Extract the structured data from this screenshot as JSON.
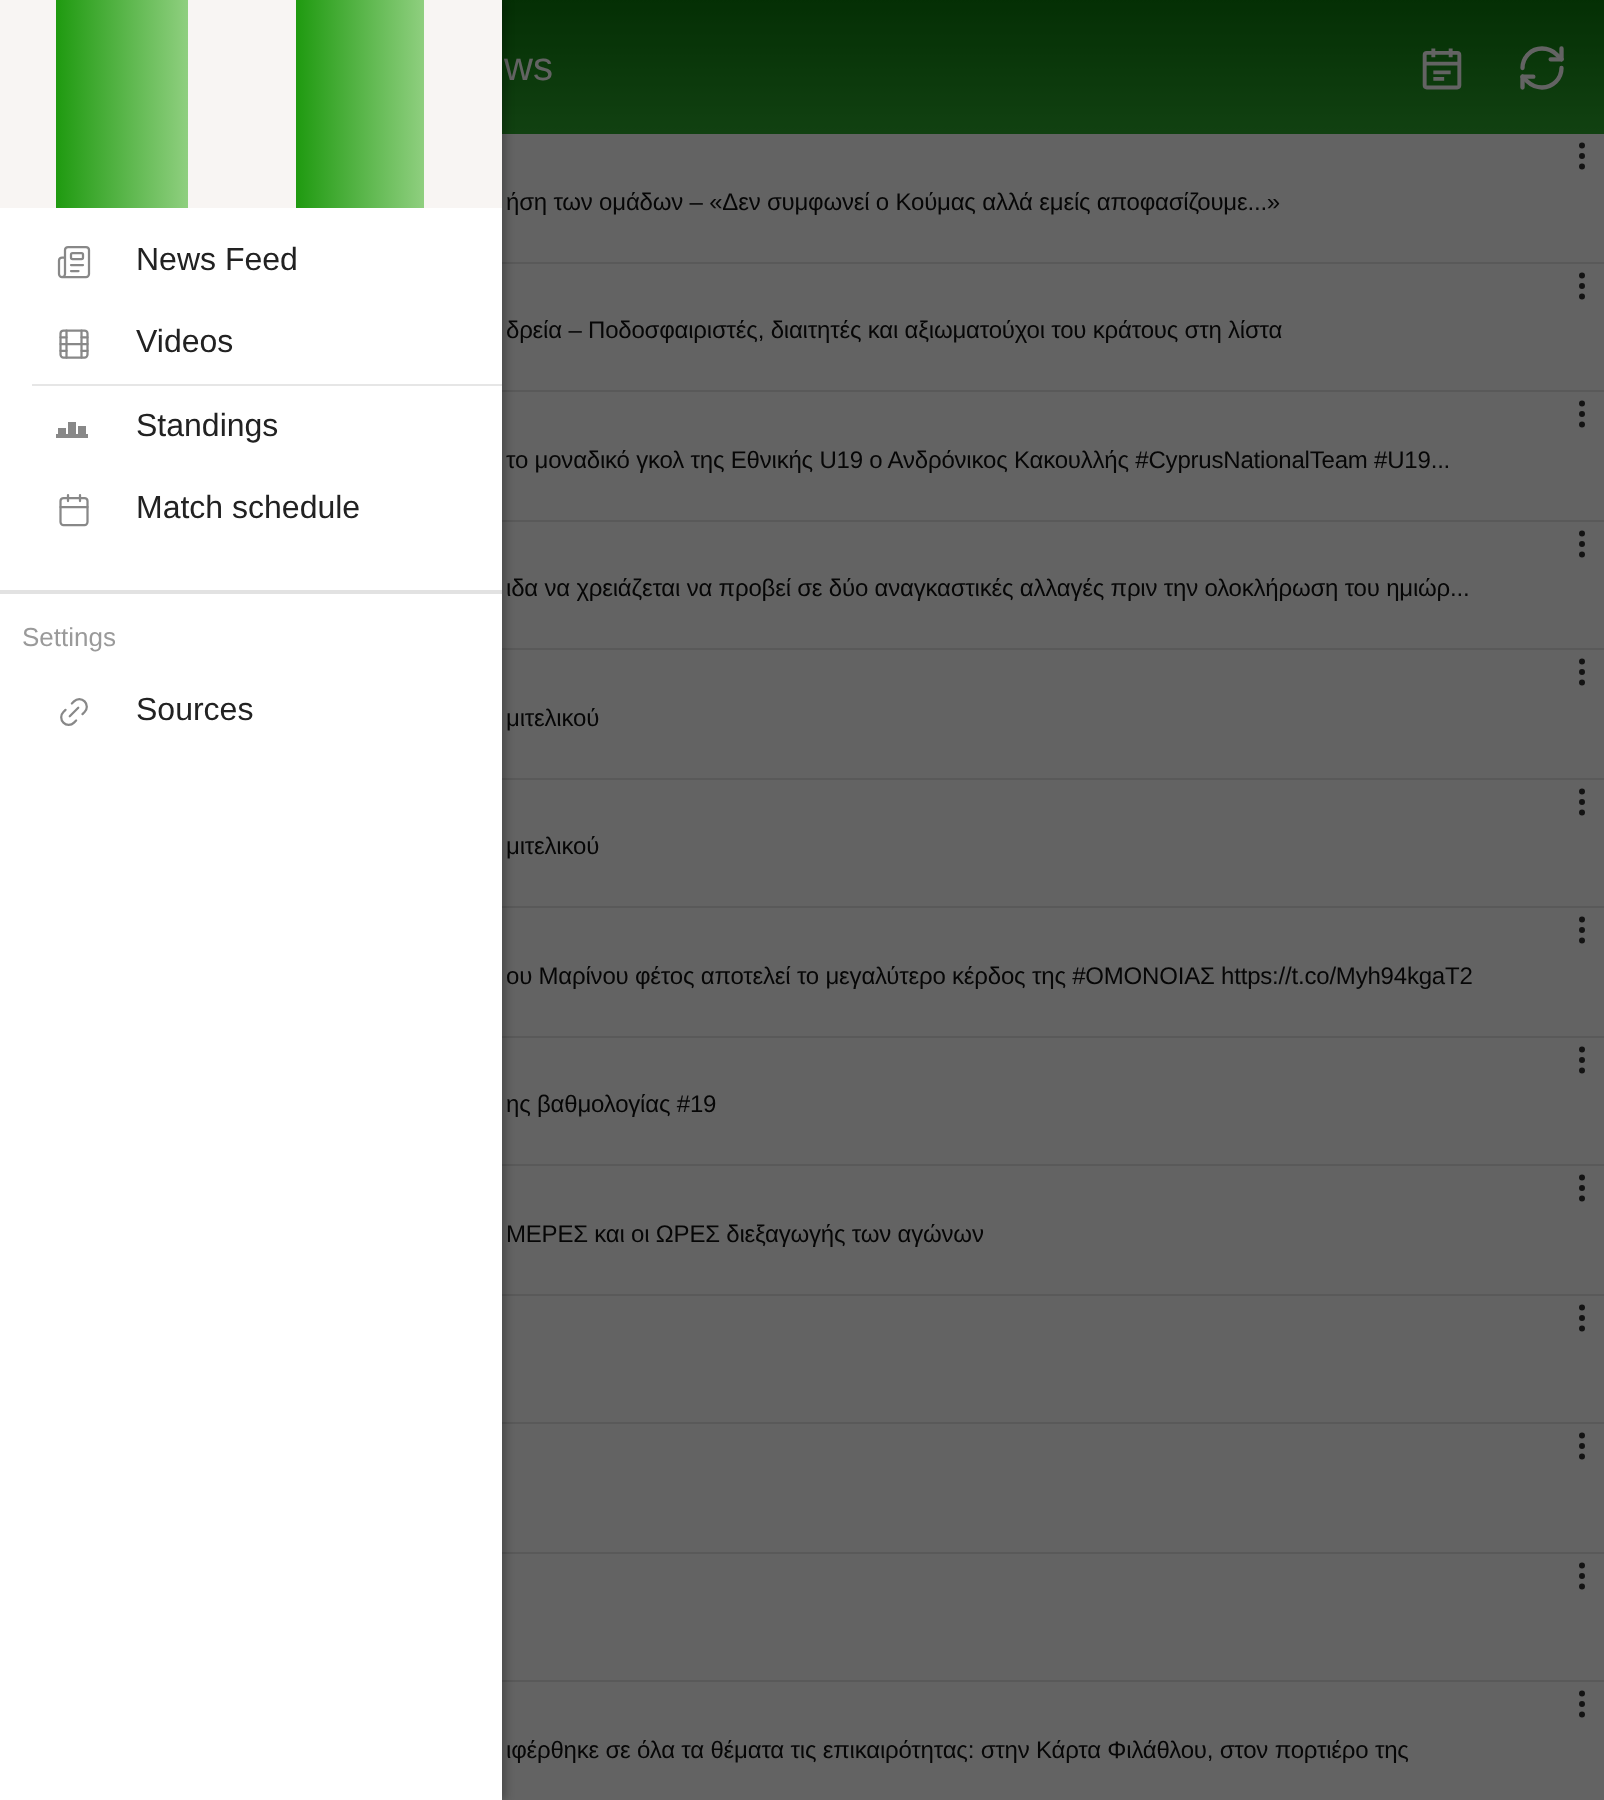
{
  "app_bar": {
    "title": "ws"
  },
  "drawer": {
    "items": [
      {
        "label": "News Feed",
        "kind": "news"
      },
      {
        "label": "Videos",
        "kind": "film"
      },
      {
        "label": "Standings",
        "kind": "podium"
      },
      {
        "label": "Match schedule",
        "kind": "calendar"
      }
    ],
    "section_label": "Settings",
    "settings_items": [
      {
        "label": "Sources",
        "kind": "link"
      }
    ]
  },
  "feed": [
    {
      "text": "ήση των ομάδων – «Δεν συμφωνεί ο Κούμας αλλά εμείς αποφασίζουμε...»"
    },
    {
      "text": "δρεία – Ποδοσφαιριστές, διαιτητές και αξιωματούχοι του κράτους στη λίστα"
    },
    {
      "text": "το μοναδικό γκολ της Εθνικής U19 ο Ανδρόνικος Κακουλλής #CyprusNationalTeam #U19..."
    },
    {
      "text": "ιδα να χρειάζεται να προβεί σε δύο αναγκαστικές αλλαγές πριν την ολοκλήρωση του ημιώρ..."
    },
    {
      "text": "μιτελικού"
    },
    {
      "text": "μιτελικού"
    },
    {
      "text": "ου Μαρίνου φέτος αποτελεί το μεγαλύτερο κέρδος της #ΟΜΟΝΟΙΑΣ https://t.co/Myh94kgaT2"
    },
    {
      "text": "ης βαθμολογίας #19"
    },
    {
      "text": "ΜΕΡΕΣ και οι ΩΡΕΣ διεξαγωγής των αγώνων"
    },
    {
      "kind": "blank"
    },
    {
      "kind": "blank"
    },
    {
      "kind": "blank"
    },
    {
      "text": "ιφέρθηκε σε όλα τα θέματα τις επικαιρότητας: στην Κάρτα Φιλάθλου, στον πορτιέρο της"
    }
  ]
}
